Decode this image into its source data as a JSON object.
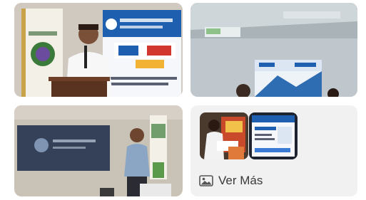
{
  "gallery": {
    "photos": [
      {
        "icon": "photo-speaker-podium"
      },
      {
        "icon": "photo-conference-room-screen"
      },
      {
        "icon": "photo-presenter-projection"
      }
    ],
    "more": {
      "label": "Ver Más",
      "icon": "image-icon",
      "thumbnails": [
        {
          "icon": "photo-thumbnail-group"
        },
        {
          "icon": "photo-thumbnail-presentation-slide"
        }
      ]
    }
  },
  "colors": {
    "card_background": "#f1f1f2",
    "text": "#3a3a3a"
  }
}
